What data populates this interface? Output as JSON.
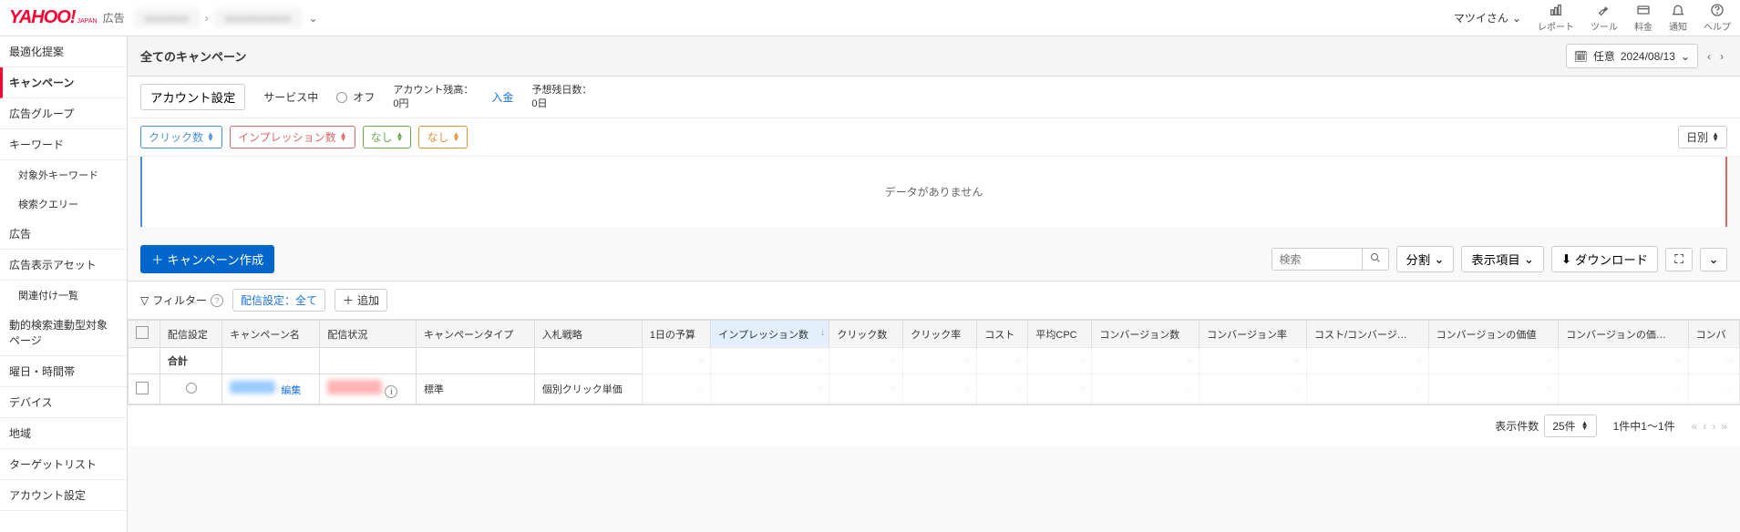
{
  "header": {
    "logo_brand": "YAHOO!",
    "logo_japan": "JAPAN",
    "logo_ad": "広告",
    "breadcrumb_item1": "xxxxxxxx",
    "breadcrumb_item2": "xxxxxxxxxxxx",
    "user_name": "マツイさん",
    "nav": {
      "report": "レポート",
      "tool": "ツール",
      "fee": "料金",
      "notify": "通知",
      "help": "ヘルプ"
    }
  },
  "sidebar": {
    "items": {
      "optimize": "最適化提案",
      "campaign": "キャンペーン",
      "adgroup": "広告グループ",
      "keyword": "キーワード",
      "neg_keyword": "対象外キーワード",
      "search_query": "検索クエリー",
      "ad": "広告",
      "ad_asset": "広告表示アセット",
      "link_list": "関連付け一覧",
      "dsa": "動的検索連動型対象ページ",
      "dayhour": "曜日・時間帯",
      "device": "デバイス",
      "region": "地域",
      "targetlist": "ターゲットリスト",
      "account": "アカウント設定"
    }
  },
  "titlebar": {
    "title": "全てのキャンペーン",
    "date_mode": "任意",
    "date_value": "2024/08/13"
  },
  "account_bar": {
    "settings_btn": "アカウント設定",
    "service_label": "サービス中",
    "off_label": "オフ",
    "balance_label": "アカウント残高：",
    "balance_value": "0円",
    "deposit_link": "入金",
    "days_label": "予想残日数：",
    "days_value": "0日"
  },
  "metrics": {
    "m1": "クリック数",
    "m2": "インプレッション数",
    "m3": "なし",
    "m4": "なし",
    "granularity": "日別"
  },
  "chart": {
    "empty_msg": "データがありません"
  },
  "toolbar": {
    "create_btn": "キャンペーン作成",
    "search_placeholder": "検索",
    "split_btn": "分割",
    "columns_btn": "表示項目",
    "download_btn": "ダウンロード"
  },
  "filter": {
    "label": "フィルター",
    "chip1": "配信設定：全て",
    "add_label": "追加"
  },
  "table": {
    "headers": {
      "delivery": "配信設定",
      "name": "キャンペーン名",
      "status": "配信状況",
      "type": "キャンペーンタイプ",
      "bid": "入札戦略",
      "budget": "1日の予算",
      "imp": "インプレッション数",
      "click": "クリック数",
      "ctr": "クリック率",
      "cost": "コスト",
      "cpc": "平均CPC",
      "conv": "コンバージョン数",
      "cvr": "コンバージョン率",
      "cost_conv": "コスト/コンバージ…",
      "conv_value": "コンバージョンの価値",
      "conv_value2": "コンバージョンの価…",
      "conv_extra": "コンバ"
    },
    "total_label": "合計",
    "row1": {
      "edit": "編集",
      "type": "標準",
      "bid": "個別クリック単価"
    }
  },
  "pagination": {
    "size_label": "表示件数",
    "size_value": "25件",
    "range": "1件中1〜1件"
  }
}
